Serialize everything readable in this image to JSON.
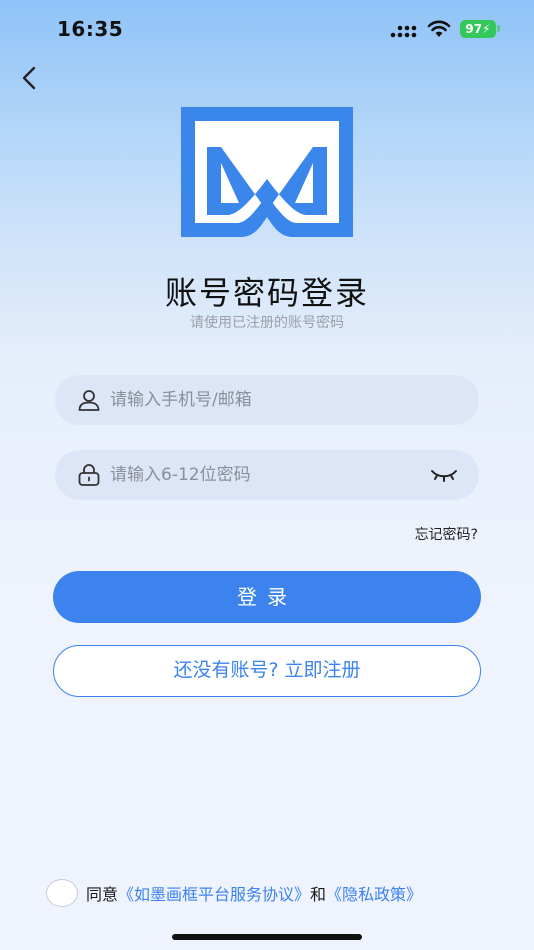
{
  "status_bar": {
    "time": "16:35",
    "battery": "97"
  },
  "header": {
    "back_icon": "chevron-left-icon",
    "logo_icon": "app-logo"
  },
  "login": {
    "title": "账号密码登录",
    "subtitle": "请使用已注册的账号密码",
    "phone_placeholder": "请输入手机号/邮箱",
    "password_placeholder": "请输入6-12位密码",
    "forgot_label": "忘记密码?",
    "login_label": "登录",
    "register_label": "还没有账号? 立即注册"
  },
  "agreement": {
    "prefix": "同意",
    "service_link": "《如墨画框平台服务协议》",
    "conjunction": "和",
    "privacy_link": "《隐私政策》"
  },
  "colors": {
    "accent": "#3d83ee",
    "logo": "#3a86ea",
    "input_bg": "#dde6f6",
    "battery": "#34c759"
  }
}
